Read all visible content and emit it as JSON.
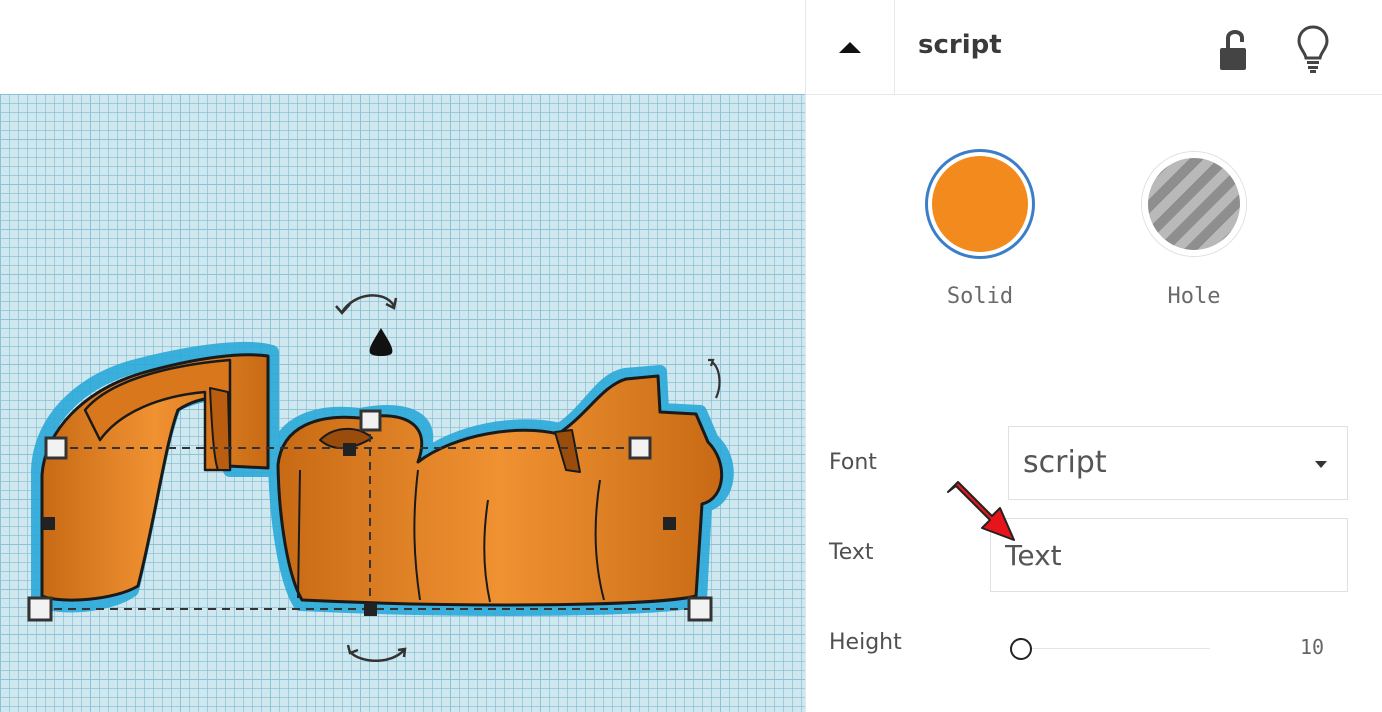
{
  "panel": {
    "shape_name": "script",
    "modes": {
      "solid_label": "Solid",
      "hole_label": "Hole"
    },
    "properties": {
      "font_label": "Font",
      "font_value": "script",
      "text_label": "Text",
      "text_value": "Text",
      "height_label": "Height",
      "height_value": "10"
    }
  },
  "colors": {
    "shape_fill": "#f28a1e",
    "selection_outline": "#29a9d8",
    "solid_ring": "#3b7ec8",
    "workplane": "#cfe8f0",
    "annotation_arrow": "#e8141b"
  },
  "icons": {
    "collapse": "caret-up-icon",
    "lock": "lock-open-icon",
    "bulb": "lightbulb-icon",
    "dropdown": "chevron-down-icon"
  }
}
